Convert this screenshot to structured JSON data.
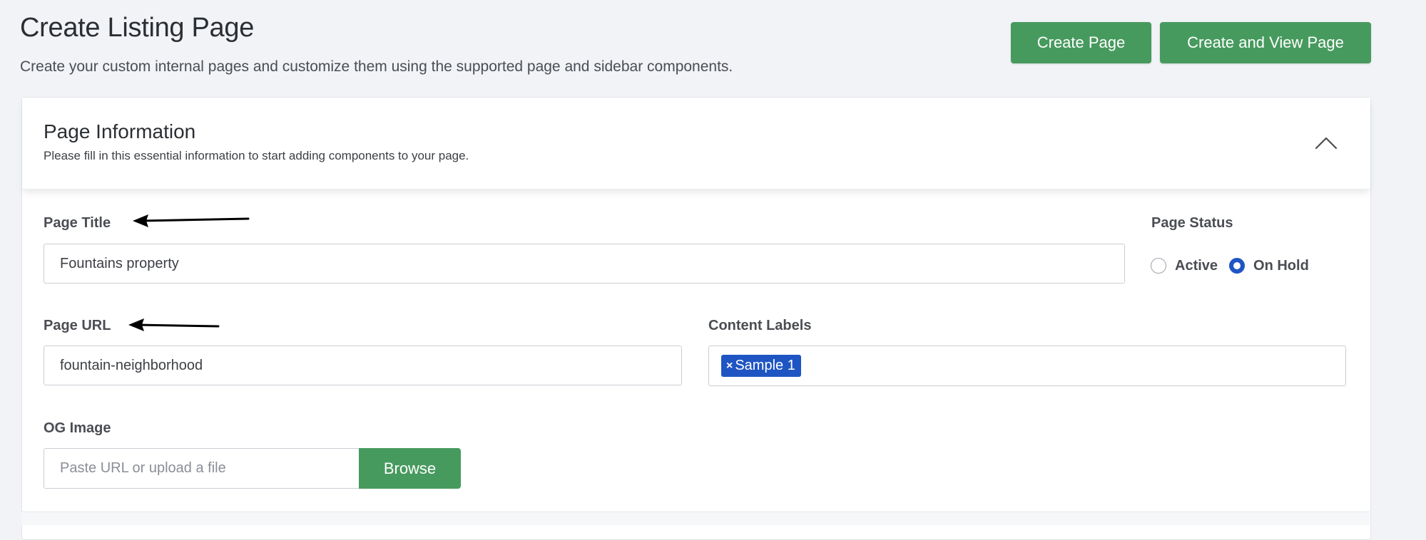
{
  "header": {
    "title": "Create Listing Page",
    "subtitle": "Create your custom internal pages and customize them using the supported page and sidebar components.",
    "create_page_label": "Create Page",
    "create_view_page_label": "Create and View Page"
  },
  "section": {
    "title": "Page Information",
    "description": "Please fill in this essential information to start adding components to your page.",
    "toggle_icon": "chevron-up-icon"
  },
  "form": {
    "page_title": {
      "label": "Page Title",
      "value": "Fountains property"
    },
    "page_status": {
      "label": "Page Status",
      "options": [
        "Active",
        "On Hold"
      ],
      "selected": "On Hold"
    },
    "page_url": {
      "label": "Page URL",
      "value": "fountain-neighborhood"
    },
    "content_labels": {
      "label": "Content Labels",
      "tags": [
        "Sample 1"
      ],
      "remove_glyph": "×"
    },
    "og_image": {
      "label": "OG Image",
      "placeholder": "Paste URL or upload a file",
      "browse_label": "Browse"
    }
  },
  "colors": {
    "accent_green": "#479a5e",
    "accent_blue": "#1f55c3",
    "background": "#f1f3f6"
  }
}
